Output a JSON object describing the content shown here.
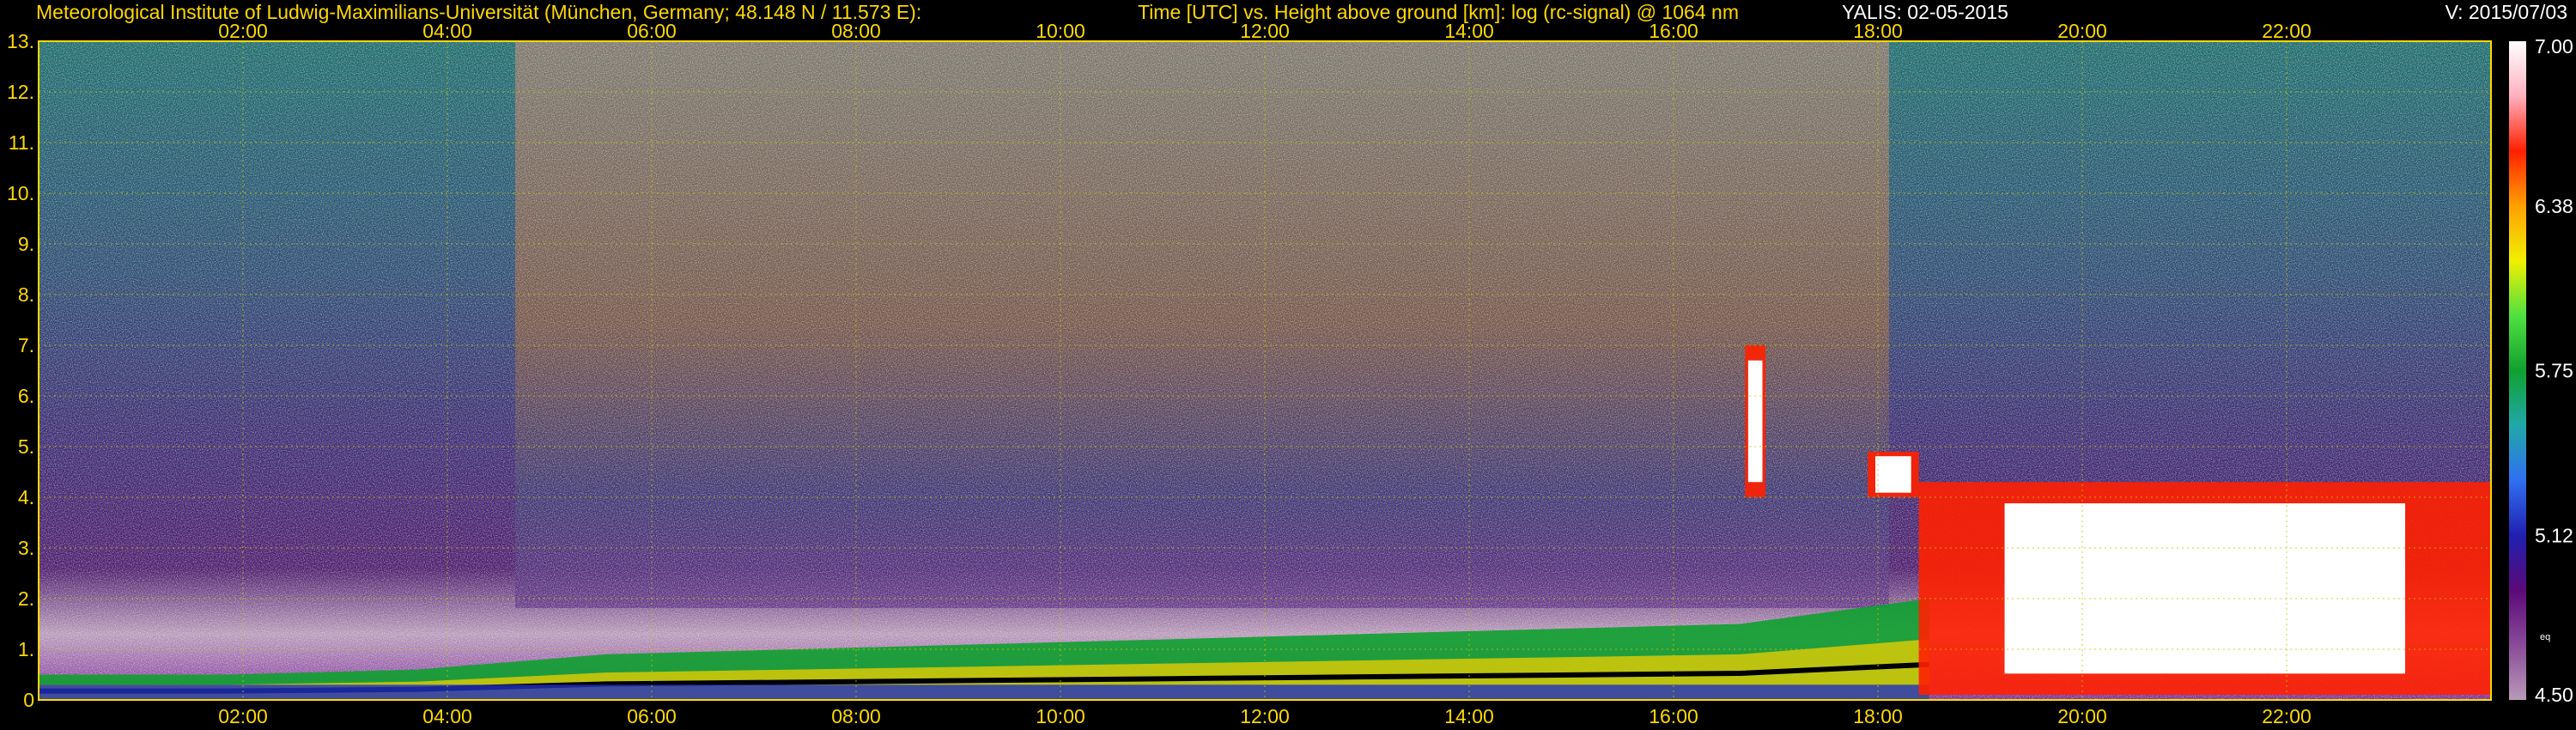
{
  "header": {
    "institute": "Meteorological Institute of Ludwig-Maximilians-Universität (München, Germany; 48.148 N / 11.573 E):",
    "axes_desc": "Time [UTC] vs. Height above ground [km]: log (rc-signal) @ 1064 nm",
    "instrument_date": "YALIS: 02-05-2015",
    "version": "V: 2015/07/03"
  },
  "colors": {
    "background": "#000000",
    "label_yellow": "#ffd800",
    "label_white": "#ffffff",
    "grid": "#c8c800"
  },
  "chart_data": {
    "type": "heatmap",
    "x_label": "Time [UTC]",
    "y_label": "Height above ground [km]",
    "quantity": "log (rc-signal) @ 1064 nm",
    "x_range_hours": [
      0,
      24
    ],
    "x_ticks": [
      "02:00",
      "04:00",
      "06:00",
      "08:00",
      "10:00",
      "12:00",
      "14:00",
      "16:00",
      "18:00",
      "20:00",
      "22:00"
    ],
    "y_range_km": [
      0,
      13
    ],
    "y_ticks": [
      "0",
      "1.",
      "2.",
      "3.",
      "4.",
      "5.",
      "6.",
      "7.",
      "8.",
      "9.",
      "10.",
      "11.",
      "12.",
      "13."
    ],
    "grid": true,
    "colorbar": {
      "min": 4.5,
      "max": 7.0,
      "labels": [
        "7.00",
        "6.38",
        "5.75",
        "5.12",
        "4.50"
      ],
      "unit_label": "eq",
      "stops": [
        "#b89ab8",
        "#8a4a98",
        "#5a0a78",
        "#2020b0",
        "#3070f0",
        "#20a8a8",
        "#10a030",
        "#50e040",
        "#f0f000",
        "#ffa000",
        "#ff2000",
        "#ffb0c0",
        "#ffffff"
      ]
    },
    "features": [
      {
        "name": "boundary layer (mixed layer)",
        "start_h": 0,
        "end_h": 18.5,
        "top_km": [
          0.5,
          0.5,
          0.6,
          0.9,
          1.0,
          1.1,
          1.2,
          1.3,
          1.4,
          1.5,
          2.0
        ]
      },
      {
        "name": "cloud",
        "start_h": 16.7,
        "end_h": 16.9,
        "bottom_km": 4.0,
        "top_km": 7.0
      },
      {
        "name": "cloud",
        "start_h": 17.9,
        "end_h": 18.4,
        "bottom_km": 4.0,
        "top_km": 4.9
      },
      {
        "name": "cloud layer",
        "start_h": 18.4,
        "end_h": 24,
        "bottom_km": 0.1,
        "top_km": 4.3
      }
    ]
  }
}
